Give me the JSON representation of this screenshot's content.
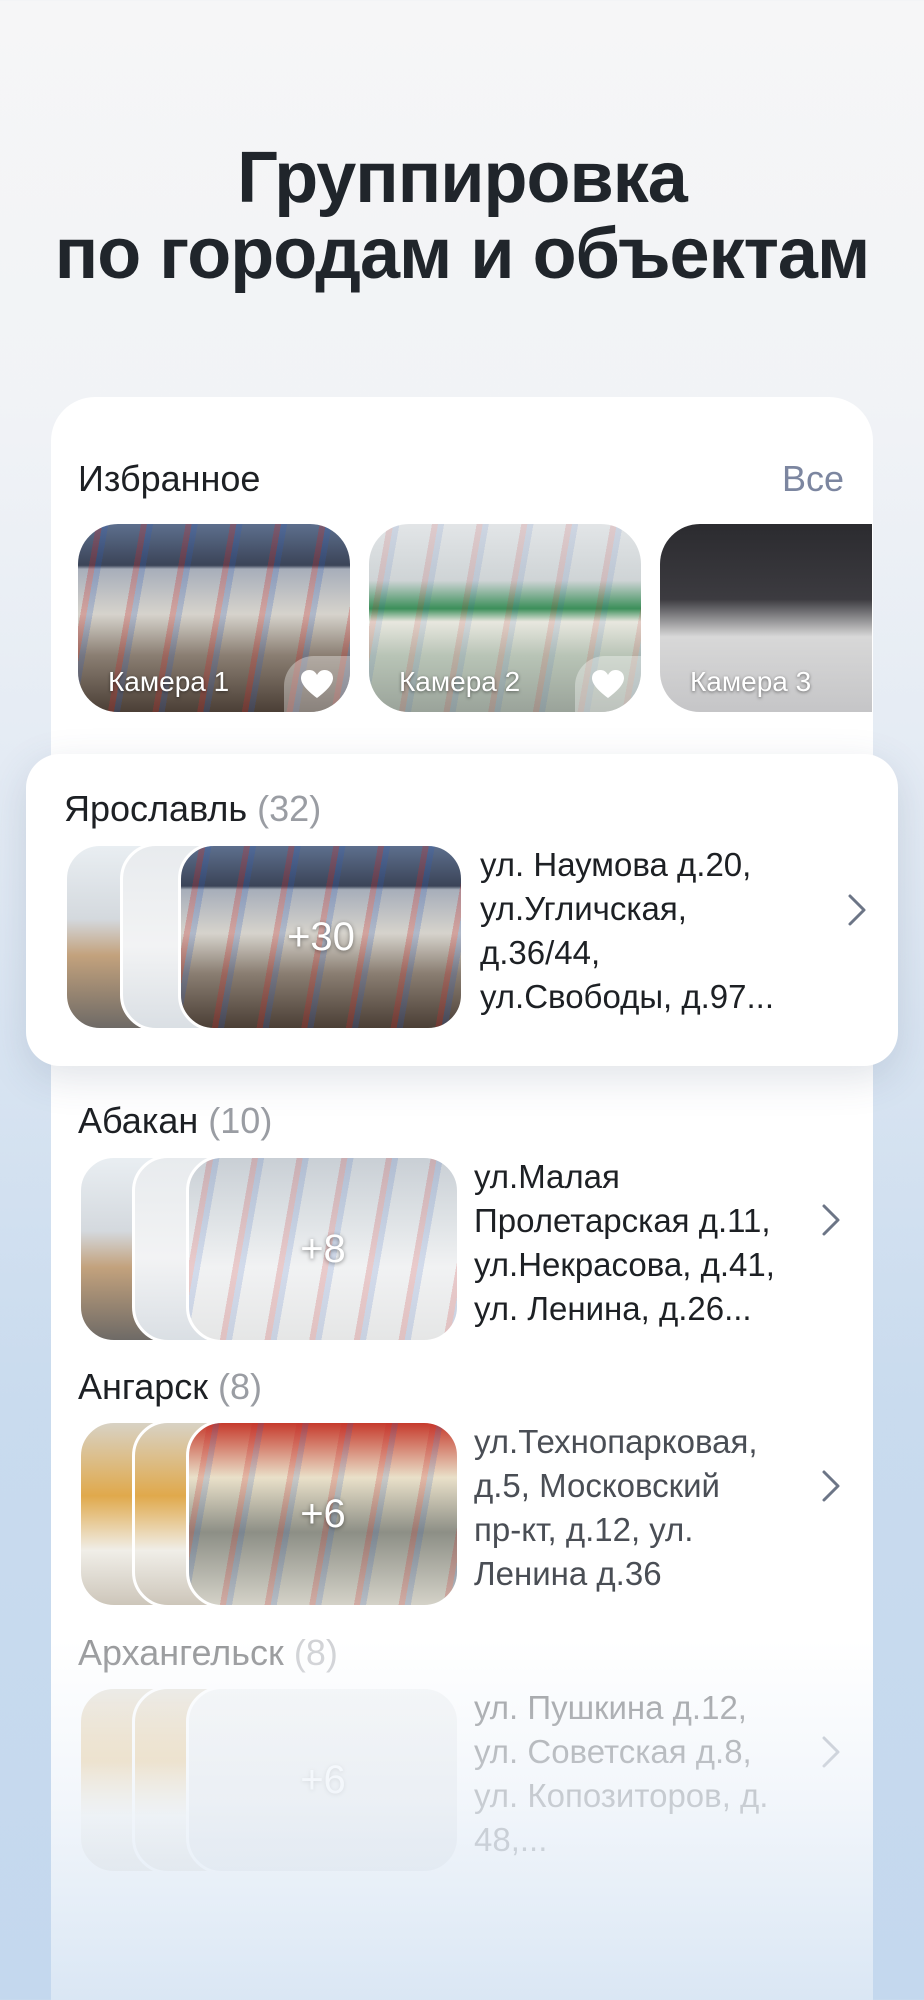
{
  "headline": {
    "line1": "Группировка",
    "line2": "по городам и объектам"
  },
  "favorites": {
    "title": "Избранное",
    "all_label": "Все",
    "cameras": [
      {
        "label": "Камера 1",
        "icon": "heart-icon"
      },
      {
        "label": "Камера 2",
        "icon": "heart-icon"
      },
      {
        "label": "Камера 3"
      }
    ]
  },
  "cities": [
    {
      "name": "Ярославль",
      "count": "(32)",
      "more": "+30",
      "address_lines": [
        "ул. Наумова д.20,",
        "ул.Угличская,",
        "д.36/44,",
        "ул.Свободы, д.97..."
      ],
      "highlighted": true
    },
    {
      "name": "Абакан",
      "count": "(10)",
      "more": "+8",
      "address_lines": [
        "ул.Малая",
        "Пролетарская д.11,",
        "ул.Некрасова, д.41,",
        "ул. Ленина, д.26..."
      ]
    },
    {
      "name": "Ангарск",
      "count": "(8)",
      "more": "+6",
      "address_lines": [
        "ул.Технопарковая,",
        "д.5, Московский",
        "пр-кт, д.12, ул.",
        "Ленина д.36"
      ]
    },
    {
      "name": "Архангельск",
      "count": "(8)",
      "more": "+6",
      "address_lines": [
        "ул. Пушкина д.12,",
        "ул. Советская д.8,",
        "ул. Копозиторов, д.",
        "48,..."
      ],
      "faded": true
    }
  ],
  "colors": {
    "accent_link": "#7c86a0",
    "text": "#1d2024",
    "count": "#9a9da3",
    "card": "#ffffff"
  }
}
